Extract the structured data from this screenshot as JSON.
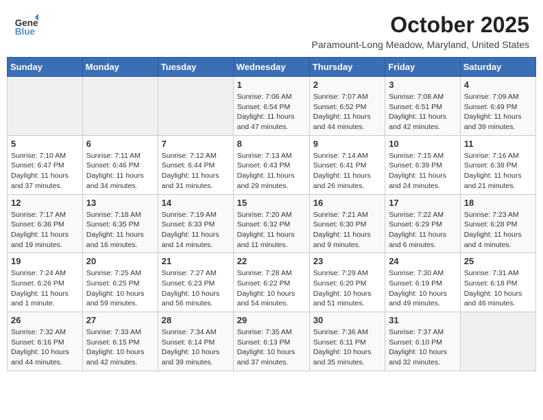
{
  "header": {
    "logo_line1": "General",
    "logo_line2": "Blue",
    "month": "October 2025",
    "location": "Paramount-Long Meadow, Maryland, United States"
  },
  "days_of_week": [
    "Sunday",
    "Monday",
    "Tuesday",
    "Wednesday",
    "Thursday",
    "Friday",
    "Saturday"
  ],
  "weeks": [
    [
      {
        "day": "",
        "info": ""
      },
      {
        "day": "",
        "info": ""
      },
      {
        "day": "",
        "info": ""
      },
      {
        "day": "1",
        "info": "Sunrise: 7:06 AM\nSunset: 6:54 PM\nDaylight: 11 hours and 47 minutes."
      },
      {
        "day": "2",
        "info": "Sunrise: 7:07 AM\nSunset: 6:52 PM\nDaylight: 11 hours and 44 minutes."
      },
      {
        "day": "3",
        "info": "Sunrise: 7:08 AM\nSunset: 6:51 PM\nDaylight: 11 hours and 42 minutes."
      },
      {
        "day": "4",
        "info": "Sunrise: 7:09 AM\nSunset: 6:49 PM\nDaylight: 11 hours and 39 minutes."
      }
    ],
    [
      {
        "day": "5",
        "info": "Sunrise: 7:10 AM\nSunset: 6:47 PM\nDaylight: 11 hours and 37 minutes."
      },
      {
        "day": "6",
        "info": "Sunrise: 7:11 AM\nSunset: 6:46 PM\nDaylight: 11 hours and 34 minutes."
      },
      {
        "day": "7",
        "info": "Sunrise: 7:12 AM\nSunset: 6:44 PM\nDaylight: 11 hours and 31 minutes."
      },
      {
        "day": "8",
        "info": "Sunrise: 7:13 AM\nSunset: 6:43 PM\nDaylight: 11 hours and 29 minutes."
      },
      {
        "day": "9",
        "info": "Sunrise: 7:14 AM\nSunset: 6:41 PM\nDaylight: 11 hours and 26 minutes."
      },
      {
        "day": "10",
        "info": "Sunrise: 7:15 AM\nSunset: 6:39 PM\nDaylight: 11 hours and 24 minutes."
      },
      {
        "day": "11",
        "info": "Sunrise: 7:16 AM\nSunset: 6:38 PM\nDaylight: 11 hours and 21 minutes."
      }
    ],
    [
      {
        "day": "12",
        "info": "Sunrise: 7:17 AM\nSunset: 6:36 PM\nDaylight: 11 hours and 19 minutes."
      },
      {
        "day": "13",
        "info": "Sunrise: 7:18 AM\nSunset: 6:35 PM\nDaylight: 11 hours and 16 minutes."
      },
      {
        "day": "14",
        "info": "Sunrise: 7:19 AM\nSunset: 6:33 PM\nDaylight: 11 hours and 14 minutes."
      },
      {
        "day": "15",
        "info": "Sunrise: 7:20 AM\nSunset: 6:32 PM\nDaylight: 11 hours and 11 minutes."
      },
      {
        "day": "16",
        "info": "Sunrise: 7:21 AM\nSunset: 6:30 PM\nDaylight: 11 hours and 9 minutes."
      },
      {
        "day": "17",
        "info": "Sunrise: 7:22 AM\nSunset: 6:29 PM\nDaylight: 11 hours and 6 minutes."
      },
      {
        "day": "18",
        "info": "Sunrise: 7:23 AM\nSunset: 6:28 PM\nDaylight: 11 hours and 4 minutes."
      }
    ],
    [
      {
        "day": "19",
        "info": "Sunrise: 7:24 AM\nSunset: 6:26 PM\nDaylight: 11 hours and 1 minute."
      },
      {
        "day": "20",
        "info": "Sunrise: 7:25 AM\nSunset: 6:25 PM\nDaylight: 10 hours and 59 minutes."
      },
      {
        "day": "21",
        "info": "Sunrise: 7:27 AM\nSunset: 6:23 PM\nDaylight: 10 hours and 56 minutes."
      },
      {
        "day": "22",
        "info": "Sunrise: 7:28 AM\nSunset: 6:22 PM\nDaylight: 10 hours and 54 minutes."
      },
      {
        "day": "23",
        "info": "Sunrise: 7:29 AM\nSunset: 6:20 PM\nDaylight: 10 hours and 51 minutes."
      },
      {
        "day": "24",
        "info": "Sunrise: 7:30 AM\nSunset: 6:19 PM\nDaylight: 10 hours and 49 minutes."
      },
      {
        "day": "25",
        "info": "Sunrise: 7:31 AM\nSunset: 6:18 PM\nDaylight: 10 hours and 46 minutes."
      }
    ],
    [
      {
        "day": "26",
        "info": "Sunrise: 7:32 AM\nSunset: 6:16 PM\nDaylight: 10 hours and 44 minutes."
      },
      {
        "day": "27",
        "info": "Sunrise: 7:33 AM\nSunset: 6:15 PM\nDaylight: 10 hours and 42 minutes."
      },
      {
        "day": "28",
        "info": "Sunrise: 7:34 AM\nSunset: 6:14 PM\nDaylight: 10 hours and 39 minutes."
      },
      {
        "day": "29",
        "info": "Sunrise: 7:35 AM\nSunset: 6:13 PM\nDaylight: 10 hours and 37 minutes."
      },
      {
        "day": "30",
        "info": "Sunrise: 7:36 AM\nSunset: 6:11 PM\nDaylight: 10 hours and 35 minutes."
      },
      {
        "day": "31",
        "info": "Sunrise: 7:37 AM\nSunset: 6:10 PM\nDaylight: 10 hours and 32 minutes."
      },
      {
        "day": "",
        "info": ""
      }
    ]
  ]
}
